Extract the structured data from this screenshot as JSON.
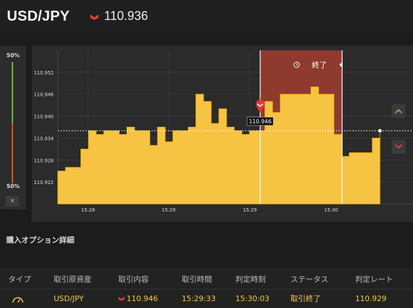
{
  "header": {
    "pair": "USD/JPY",
    "price": "110.936",
    "direction_icon": "down-arrow-icon",
    "down_color": "#e53935"
  },
  "sentiment": {
    "top_percent": "50%",
    "bottom_percent": "50%",
    "close_label": "×",
    "up_color": "#7cb342",
    "down_color": "#e0542a"
  },
  "chart": {
    "y_ticks": [
      "110.952",
      "110.946",
      "110.940",
      "110.934",
      "110.928",
      "110.922"
    ],
    "x_ticks": [
      "15:28",
      "15:29",
      "15:29",
      "15:30"
    ],
    "entry_label": "110.946",
    "end_label": "終了",
    "area_color": "#f6c343",
    "expired_band_color": "#8e3a2e"
  },
  "chart_data": {
    "type": "area",
    "xlabel": "",
    "ylabel": "",
    "ylim": [
      110.916,
      110.958
    ],
    "x_tick_labels": [
      "15:28",
      "15:29",
      "15:29",
      "15:30"
    ],
    "series": [
      {
        "values": [
          110.925,
          110.926,
          110.926,
          110.931,
          110.936,
          110.935,
          110.936,
          110.936,
          110.935,
          110.937,
          110.936,
          110.936,
          110.932,
          110.937,
          110.933,
          110.936,
          110.936,
          110.937,
          110.946,
          110.944,
          110.938,
          110.942,
          110.937,
          110.936,
          110.935,
          110.936,
          110.936,
          110.944,
          110.941,
          110.946,
          110.946,
          110.946,
          110.946,
          110.948,
          110.946,
          110.946,
          110.935,
          110.929,
          110.93,
          110.93,
          110.93,
          110.934,
          110.936
        ]
      }
    ],
    "current_rate": 110.936,
    "entry_rate": 110.946,
    "y_ticks": [
      110.952,
      110.946,
      110.94,
      110.934,
      110.928,
      110.922
    ]
  },
  "details": {
    "title": "購入オプション詳細",
    "columns": [
      "タイプ",
      "取引原資産",
      "取引内容",
      "取引時間",
      "判定時刻",
      "ステータス",
      "判定レート"
    ],
    "row": {
      "type_icon": "gauge-icon",
      "asset": "USD/JPY",
      "trade": "110.946",
      "trade_icon": "down-arrow-icon",
      "trade_time": "15:29:33",
      "judge_time": "15:30:03",
      "status": "取引終了",
      "rate": "110.929"
    }
  }
}
